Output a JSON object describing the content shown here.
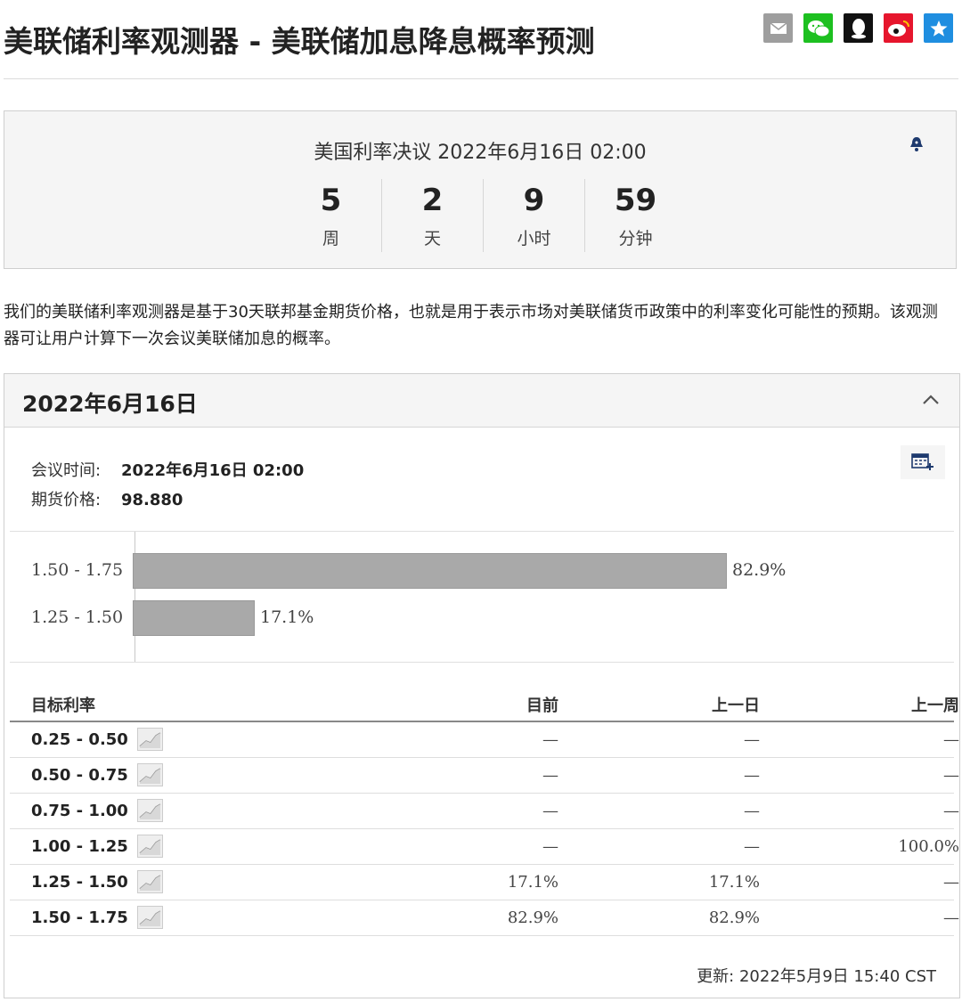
{
  "page": {
    "title": "美联储利率观测器 - 美联储加息降息概率预测"
  },
  "share_icons": [
    "mail-icon",
    "wechat-icon",
    "qq-icon",
    "weibo-icon",
    "favorite-icon"
  ],
  "countdown": {
    "title": "美国利率决议 2022年6月16日 02:00",
    "cells": [
      {
        "num": "5",
        "unit": "周"
      },
      {
        "num": "2",
        "unit": "天"
      },
      {
        "num": "9",
        "unit": "小时"
      },
      {
        "num": "59",
        "unit": "分钟"
      }
    ]
  },
  "description": "我们的美联储利率观测器是基于30天联邦基金期货价格，也就是用于表示市场对美联储货币政策中的利率变化可能性的预期。该观测器可让用户计算下一次会议美联储加息的概率。",
  "panel": {
    "date": "2022年6月16日",
    "meeting_time_label": "会议时间:",
    "meeting_time_value": "2022年6月16日 02:00",
    "futures_price_label": "期货价格:",
    "futures_price_value": "98.880",
    "updated": "更新: 2022年5月9日 15:40 CST"
  },
  "chart_data": {
    "type": "bar",
    "orientation": "horizontal",
    "categories": [
      "1.50 - 1.75",
      "1.25 - 1.50"
    ],
    "values": [
      82.9,
      17.1
    ],
    "value_labels": [
      "82.9%",
      "17.1%"
    ],
    "xlim": [
      0,
      100
    ]
  },
  "table": {
    "headers": [
      "目标利率",
      "目前",
      "上一日",
      "上一周"
    ],
    "rows": [
      {
        "rate": "0.25 - 0.50",
        "current": "—",
        "prev_day": "—",
        "prev_week": "—"
      },
      {
        "rate": "0.50 - 0.75",
        "current": "—",
        "prev_day": "—",
        "prev_week": "—"
      },
      {
        "rate": "0.75 - 1.00",
        "current": "—",
        "prev_day": "—",
        "prev_week": "—"
      },
      {
        "rate": "1.00 - 1.25",
        "current": "—",
        "prev_day": "—",
        "prev_week": "100.0%"
      },
      {
        "rate": "1.25 - 1.50",
        "current": "17.1%",
        "prev_day": "17.1%",
        "prev_week": "—"
      },
      {
        "rate": "1.50 - 1.75",
        "current": "82.9%",
        "prev_day": "82.9%",
        "prev_week": "—"
      }
    ]
  }
}
